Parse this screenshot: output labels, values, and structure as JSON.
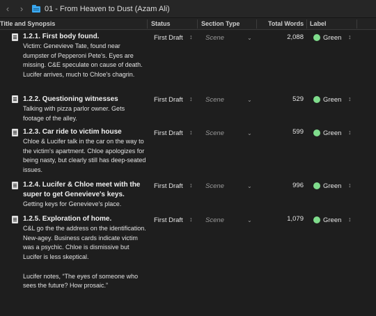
{
  "toolbar": {
    "back_icon": "chevron-left-icon",
    "forward_icon": "chevron-right-icon",
    "folder_icon": "folder-icon",
    "document_title": "01 - From Heaven to Dust (Azam Ali)"
  },
  "columns": {
    "title": "Title and Synopsis",
    "status": "Status",
    "section_type": "Section Type",
    "total_words": "Total Words",
    "label": "Label"
  },
  "colors": {
    "label_green": "#7fdc8c",
    "folder_blue": "#3aa8f0"
  },
  "rows": [
    {
      "title": "1.2.1. First body found.",
      "synopsis": "Victim: Genevieve Tate, found near dumpster of Pepperoni Pete's.  Eyes are missing.  C&E speculate on cause of death.  Lucifer arrives, much to Chloe's chagrin.",
      "status": "First Draft",
      "section_type": "Scene",
      "words": "2,088",
      "label": "Green"
    },
    {
      "title": "1.2.2. Questioning witnesses",
      "synopsis": "Talking with pizza parlor owner.  Gets footage of the alley.",
      "status": "First Draft",
      "section_type": "Scene",
      "words": "529",
      "label": "Green"
    },
    {
      "title": "1.2.3. Car ride to victim house",
      "synopsis": "Chloe & Lucifer talk in the car on the way to the victim's apartment.  Chloe apologizes for being nasty, but clearly still has deep-seated issues.",
      "status": "First Draft",
      "section_type": "Scene",
      "words": "599",
      "label": "Green"
    },
    {
      "title": "1.2.4. Lucifer & Chloe meet with the super to get Genevieve's keys.",
      "synopsis": "Getting keys for Genevieve's place.",
      "status": "First Draft",
      "section_type": "Scene",
      "words": "996",
      "label": "Green"
    },
    {
      "title": "1.2.5. Exploration of home.",
      "synopsis": "C&L go the the address on the identification.  New-agey.  Business cards indicate victim was a psychic.  Chloe is dismissive but Lucifer is less skeptical.\n\nLucifer notes, “The eyes of someone who sees the future?  How prosaic.”",
      "status": "First Draft",
      "section_type": "Scene",
      "words": "1,079",
      "label": "Green"
    }
  ]
}
